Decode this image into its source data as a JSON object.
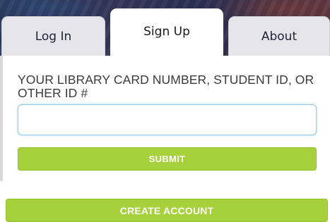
{
  "tabs": {
    "login": "Log In",
    "signup": "Sign Up",
    "about": "About"
  },
  "form": {
    "label": "YOUR LIBRARY CARD NUMBER, STUDENT ID, OR OTHER ID #",
    "input_value": "",
    "submit_label": "SUBMIT"
  },
  "create_account_label": "CREATE ACCOUNT",
  "colors": {
    "button_green": "#a6d13a",
    "tab_gray": "#e6e6ea",
    "input_focus_blue": "#9ec9e3"
  }
}
